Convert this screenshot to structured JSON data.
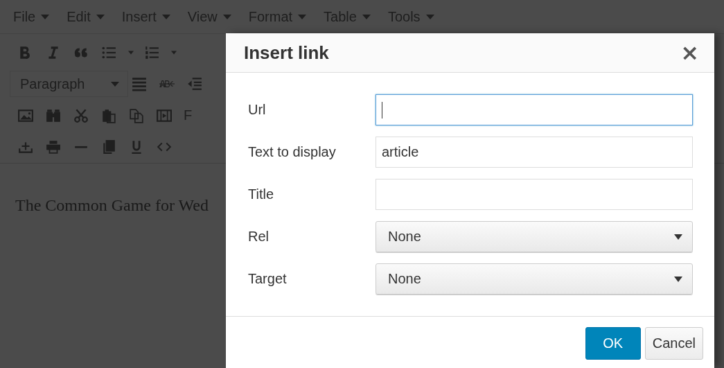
{
  "menu": [
    {
      "label": "File"
    },
    {
      "label": "Edit"
    },
    {
      "label": "Insert"
    },
    {
      "label": "View"
    },
    {
      "label": "Format"
    },
    {
      "label": "Table"
    },
    {
      "label": "Tools"
    }
  ],
  "toolbar": {
    "format_select": "Paragraph",
    "row_3_label": "F"
  },
  "content": {
    "text": "The Common Game for Wed"
  },
  "dialog": {
    "title": "Insert link",
    "close": "×",
    "fields": [
      {
        "label": "Url",
        "kind": "text",
        "focused": true
      },
      {
        "label": "Text to display",
        "kind": "text",
        "value": "article",
        "focused": false
      },
      {
        "label": "Title",
        "kind": "text",
        "focused": false
      },
      {
        "label": "Rel",
        "kind": "select",
        "value": "None",
        "focused": false
      },
      {
        "label": "Target",
        "kind": "select",
        "value": "None",
        "focused": false
      }
    ],
    "buttons": [
      {
        "label": "OK",
        "kind": "primary"
      },
      {
        "label": "Cancel",
        "kind": "secondary"
      }
    ]
  }
}
